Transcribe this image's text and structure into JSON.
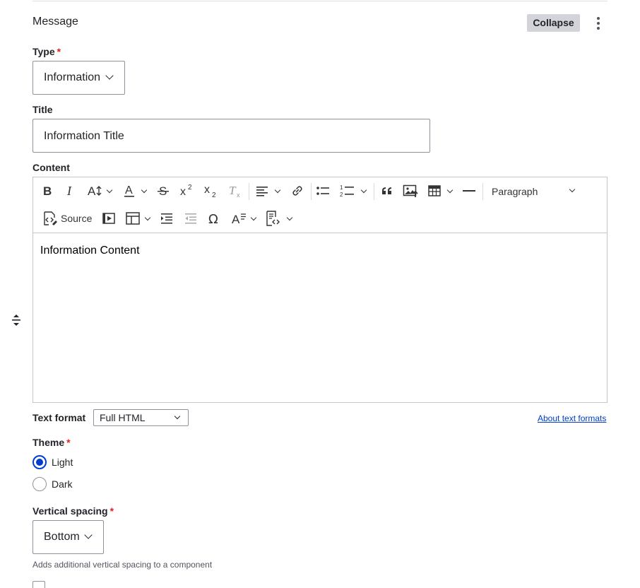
{
  "paragraph": {
    "title": "Message",
    "collapse_label": "Collapse",
    "menu_icon": "kebab-icon"
  },
  "type_field": {
    "label": "Type",
    "required_mark": "*",
    "value": "Information"
  },
  "title_field": {
    "label": "Title",
    "value": "Information Title"
  },
  "content_field": {
    "label": "Content",
    "toolbar": {
      "source_label": "Source",
      "heading_value": "Paragraph",
      "icons": [
        "bold-icon",
        "italic-icon",
        "font-size-icon",
        "font-color-icon",
        "strikethrough-icon",
        "superscript-icon",
        "subscript-icon",
        "remove-format-icon",
        "align-icon",
        "link-icon",
        "bulleted-list-icon",
        "numbered-list-icon",
        "block-quote-icon",
        "insert-image-icon",
        "table-icon",
        "horizontal-line-icon",
        "source-icon",
        "media-icon",
        "layout-table-icon",
        "indent-icon",
        "outdent-icon",
        "special-characters-icon",
        "style-icon",
        "code-block-icon"
      ]
    },
    "body_text": "Information Content"
  },
  "text_format": {
    "label": "Text format",
    "value": "Full HTML",
    "about_link": "About text formats"
  },
  "theme_field": {
    "label": "Theme",
    "required_mark": "*",
    "options": [
      {
        "label": "Light",
        "selected": true
      },
      {
        "label": "Dark",
        "selected": false
      }
    ]
  },
  "spacing_field": {
    "label": "Vertical spacing",
    "required_mark": "*",
    "value": "Bottom",
    "description": "Adds additional vertical spacing to a component"
  },
  "colors": {
    "accent": "#003ecc",
    "required": "#dc2323",
    "link": "#003cc5"
  }
}
